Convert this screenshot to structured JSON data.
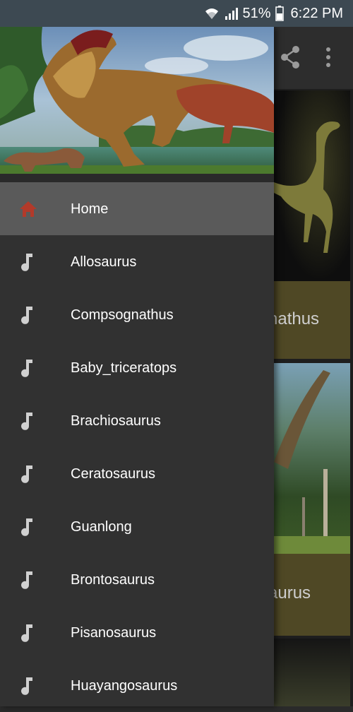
{
  "status_bar": {
    "battery": "51%",
    "time": "6:22 PM",
    "icons": [
      "wifi-icon",
      "signal-icon",
      "battery-icon"
    ]
  },
  "toolbar": {
    "icons": [
      "share-icon",
      "more-vert-icon"
    ]
  },
  "background_cards": [
    {
      "caption": "nathus"
    },
    {
      "caption": "aurus"
    }
  ],
  "drawer": {
    "header_image": "tyrannosaurus-scene",
    "items": [
      {
        "label": "Home",
        "icon": "home-icon",
        "active": true
      },
      {
        "label": "Allosaurus",
        "icon": "music-note-icon"
      },
      {
        "label": "Compsognathus",
        "icon": "music-note-icon"
      },
      {
        "label": "Baby_triceratops",
        "icon": "music-note-icon"
      },
      {
        "label": "Brachiosaurus",
        "icon": "music-note-icon"
      },
      {
        "label": "Ceratosaurus",
        "icon": "music-note-icon"
      },
      {
        "label": "Guanlong",
        "icon": "music-note-icon"
      },
      {
        "label": "Brontosaurus",
        "icon": "music-note-icon"
      },
      {
        "label": "Pisanosaurus",
        "icon": "music-note-icon"
      },
      {
        "label": "Huayangosaurus",
        "icon": "music-note-icon"
      }
    ]
  },
  "colors": {
    "drawer_bg": "#313131",
    "active_item_bg": "#5a5a5a",
    "home_icon": "#b23a2a",
    "note_icon": "#d0d0d0",
    "status_bar": "#3d4952"
  }
}
